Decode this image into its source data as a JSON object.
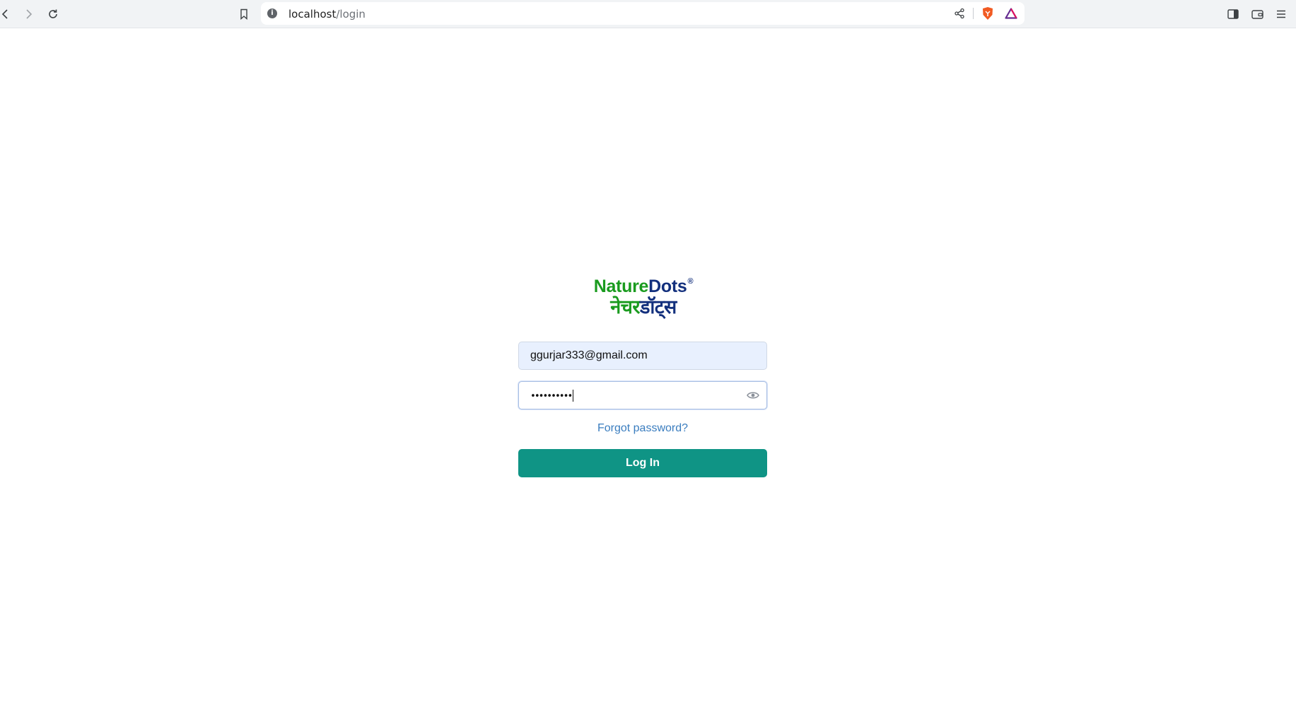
{
  "browser": {
    "url_host": "localhost",
    "url_path": "/login",
    "icons": [
      "back-icon",
      "forward-icon",
      "reload-icon",
      "bookmark-icon",
      "site-info-icon",
      "share-icon",
      "brave-shields-icon",
      "brave-rewards-icon",
      "sidebar-icon",
      "wallet-icon",
      "menu-icon"
    ]
  },
  "brand": {
    "name_part1": "Nature",
    "name_part2": "Dots",
    "registered_mark": "®",
    "hindi_part1": "नेचर",
    "hindi_part2": "डॉट्स",
    "colors": {
      "green": "#1a9b1f",
      "blue": "#13307d"
    }
  },
  "login": {
    "email_value": "ggurjar333@gmail.com",
    "password_mask": "••••••••••",
    "forgot_label": "Forgot password?",
    "submit_label": "Log In",
    "accent_color": "#0f9485"
  }
}
